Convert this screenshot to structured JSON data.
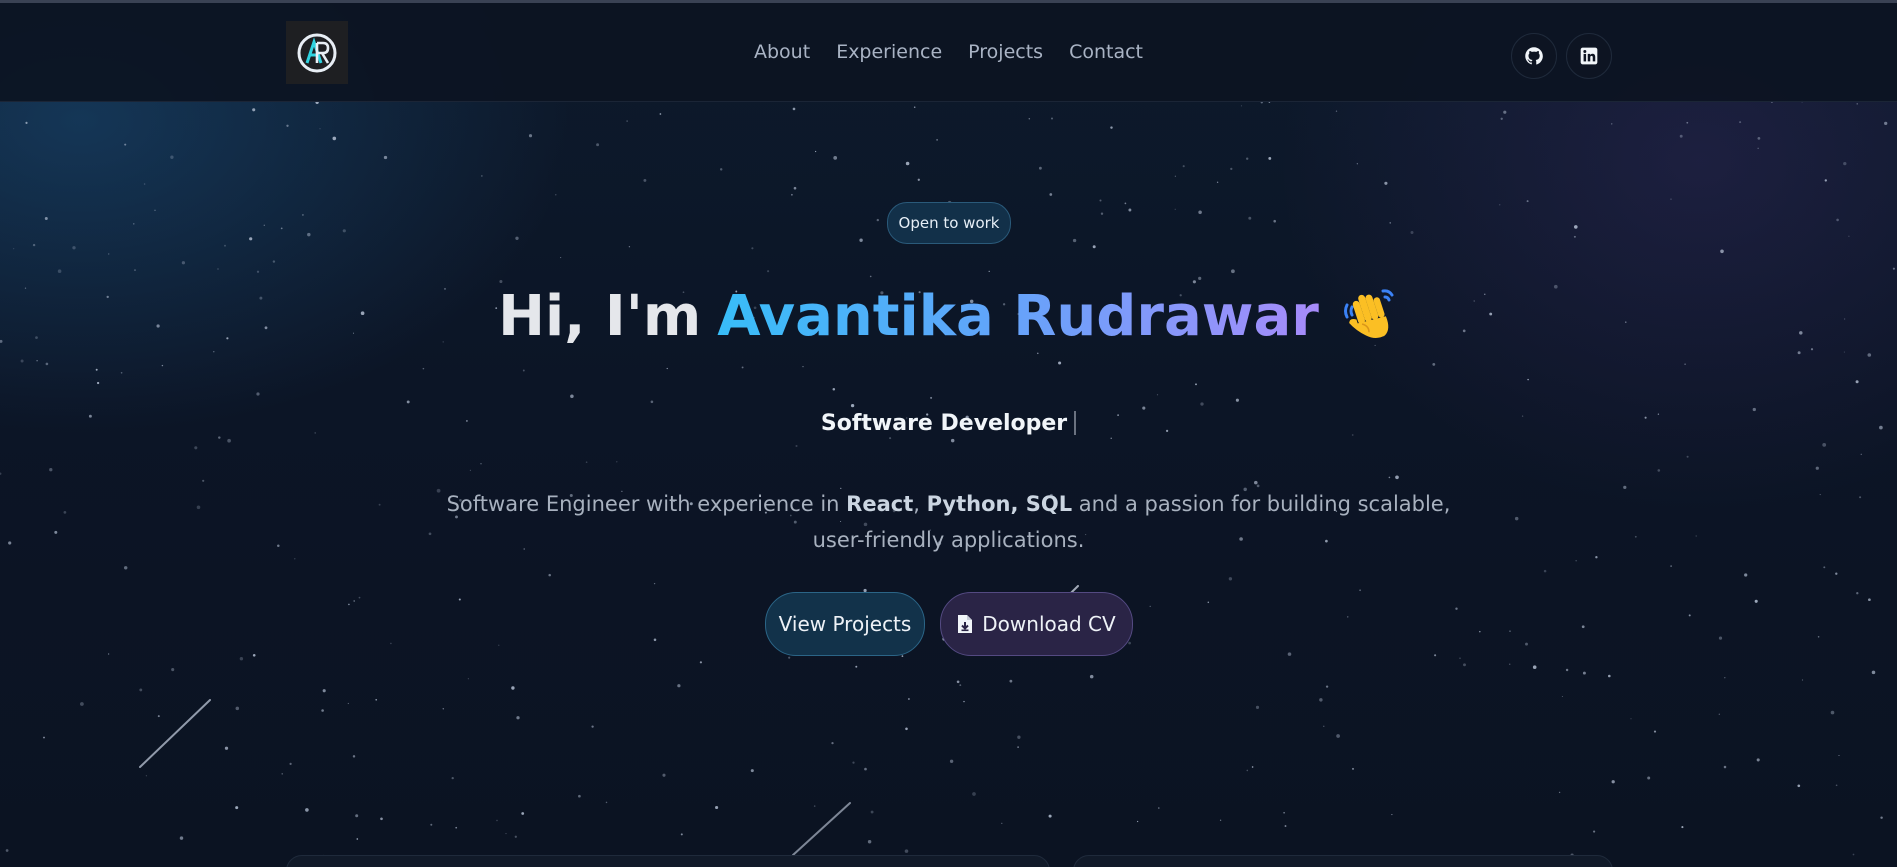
{
  "nav": {
    "logo_text": "AR",
    "links": [
      "About",
      "Experience",
      "Projects",
      "Contact"
    ],
    "social": [
      {
        "icon": "github-icon"
      },
      {
        "icon": "linkedin-icon"
      }
    ]
  },
  "hero": {
    "badge": "Open to work",
    "greeting": "Hi, I'm",
    "name": "Avantika Rudrawar",
    "wave_icon": "waving-hand-icon",
    "role": "Software Developer",
    "description": {
      "before": "Software Engineer with experience in ",
      "skill_1": "React",
      "comma": ", ",
      "skill_rest": "Python, SQL",
      "after": " and a passion for building scalable, user-friendly applications."
    },
    "buttons": {
      "view_projects": "View Projects",
      "download_cv": "Download CV"
    }
  },
  "colors": {
    "background": "#0b1220",
    "name_gradient_start": "#38bdf8",
    "name_gradient_end": "#a78bfa",
    "logo_accent": "#2fd3e0"
  }
}
